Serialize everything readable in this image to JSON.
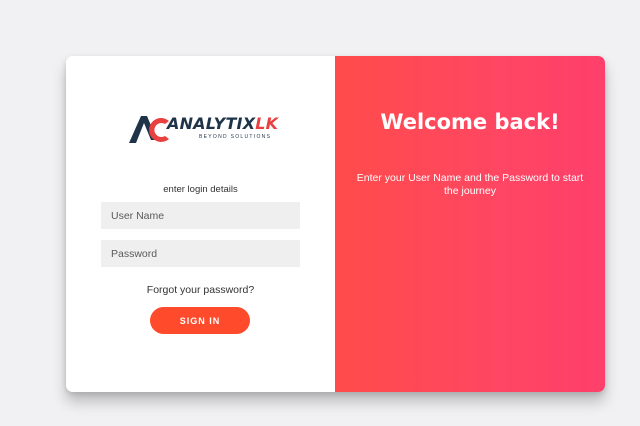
{
  "brand": {
    "name_main": "ANALYTIX",
    "name_accent": "LK",
    "tagline": "BEYOND SOLUTIONS"
  },
  "login": {
    "instruction": "enter login details",
    "username_placeholder": "User Name",
    "password_placeholder": "Password",
    "forgot_link": "Forgot your password?",
    "signin_label": "SIGN IN"
  },
  "welcome": {
    "title": "Welcome back!",
    "subtitle": "Enter your User Name and the Password to start the journey"
  },
  "colors": {
    "accent": "#ff4b2b",
    "panel_gradient_start": "#ff4b4b",
    "panel_gradient_end": "#fe3f6b",
    "brand_navy": "#1f3349",
    "brand_red": "#e8413f"
  }
}
